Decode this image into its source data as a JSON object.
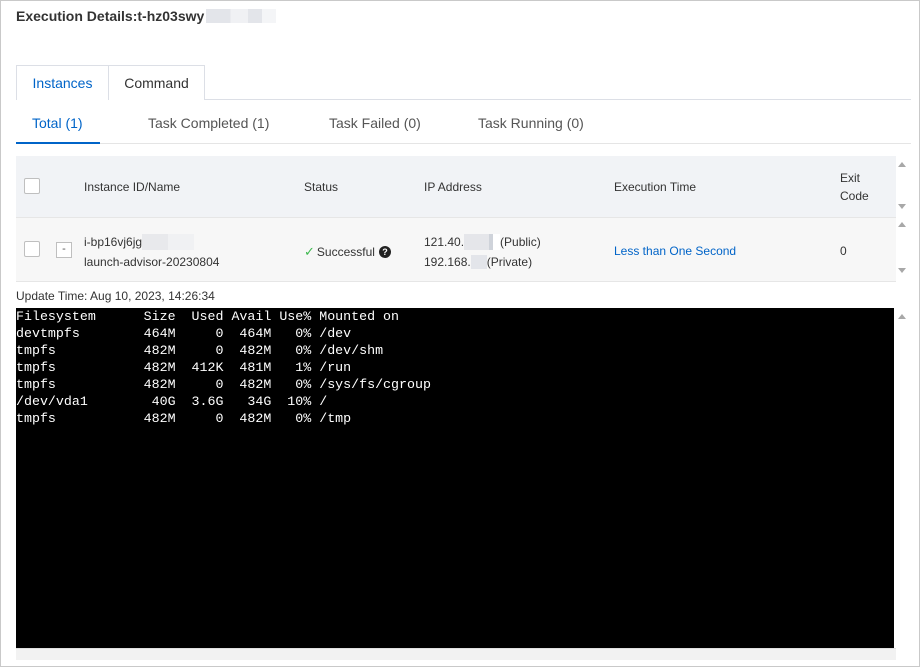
{
  "header": {
    "title": "Execution Details:t-hz03swy"
  },
  "tabs": [
    {
      "label": "Instances",
      "active": true
    },
    {
      "label": "Command",
      "active": false
    }
  ],
  "subtabs": [
    {
      "label": "Total (1)",
      "active": true
    },
    {
      "label": "Task Completed (1)",
      "active": false
    },
    {
      "label": "Task Failed (0)",
      "active": false
    },
    {
      "label": "Task Running (0)",
      "active": false
    }
  ],
  "table": {
    "columns": {
      "instance": "Instance ID/Name",
      "status": "Status",
      "ip": "IP Address",
      "exec_time": "Execution Time",
      "exit_code_1": "Exit",
      "exit_code_2": "Code"
    },
    "rows": [
      {
        "expand": "-",
        "instance_id": "i-bp16vj6jg",
        "instance_name": "launch-advisor-20230804",
        "status_icon": "check-icon",
        "status": "Successful",
        "help": "?",
        "ip_public": "121.40.",
        "ip_public_label": "(Public)",
        "ip_private": "192.168.",
        "ip_private_label": "(Private)",
        "exec_time": "Less than One Second",
        "exit_code": "0"
      }
    ]
  },
  "update_time": "Update Time: Aug 10, 2023, 14:26:34",
  "terminal": {
    "lines": [
      "Filesystem      Size  Used Avail Use% Mounted on",
      "devtmpfs        464M     0  464M   0% /dev",
      "tmpfs           482M     0  482M   0% /dev/shm",
      "tmpfs           482M  412K  481M   1% /run",
      "tmpfs           482M     0  482M   0% /sys/fs/cgroup",
      "/dev/vda1        40G  3.6G   34G  10% /",
      "tmpfs           482M     0  482M   0% /tmp"
    ]
  },
  "colors": {
    "accent": "#0064c8",
    "success": "#3fb950",
    "terminal_bg": "#000000"
  }
}
